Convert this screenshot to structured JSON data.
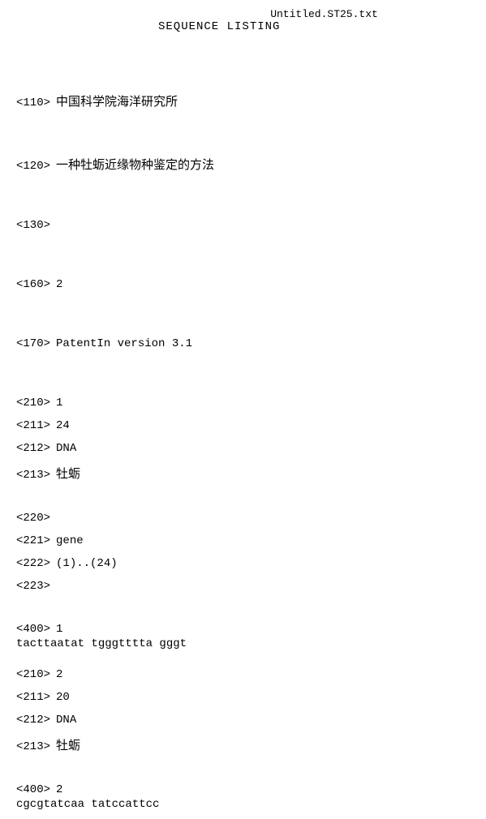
{
  "filename": "Untitled.ST25.txt",
  "heading": "SEQUENCE LISTING",
  "entries": {
    "e110": {
      "tag": "<110>",
      "value": "中国科学院海洋研究所"
    },
    "e120": {
      "tag": "<120>",
      "value": "一种牡蛎近缘物种鉴定的方法"
    },
    "e130": {
      "tag": "<130>",
      "value": ""
    },
    "e160": {
      "tag": "<160>",
      "value": "2"
    },
    "e170": {
      "tag": "<170>",
      "value": "PatentIn version 3.1"
    },
    "s1_210": {
      "tag": "<210>",
      "value": "1"
    },
    "s1_211": {
      "tag": "<211>",
      "value": "24"
    },
    "s1_212": {
      "tag": "<212>",
      "value": "DNA"
    },
    "s1_213": {
      "tag": "<213>",
      "value": "牡蛎"
    },
    "s1_220": {
      "tag": "<220>",
      "value": ""
    },
    "s1_221": {
      "tag": "<221>",
      "value": "gene"
    },
    "s1_222": {
      "tag": "<222>",
      "value": "(1)..(24)"
    },
    "s1_223": {
      "tag": "<223>",
      "value": ""
    },
    "s1_400": {
      "tag": "<400>",
      "value": "1"
    },
    "s1_seq": {
      "sequence": "tacttaatat tgggtttta gggt",
      "length": "24"
    },
    "s2_210": {
      "tag": "<210>",
      "value": "2"
    },
    "s2_211": {
      "tag": "<211>",
      "value": "20"
    },
    "s2_212": {
      "tag": "<212>",
      "value": "DNA"
    },
    "s2_213": {
      "tag": "<213>",
      "value": "牡蛎"
    },
    "s2_400": {
      "tag": "<400>",
      "value": "2"
    },
    "s2_seq": {
      "sequence": "cgcgtatcaa tatccattcc",
      "length": "20"
    }
  }
}
